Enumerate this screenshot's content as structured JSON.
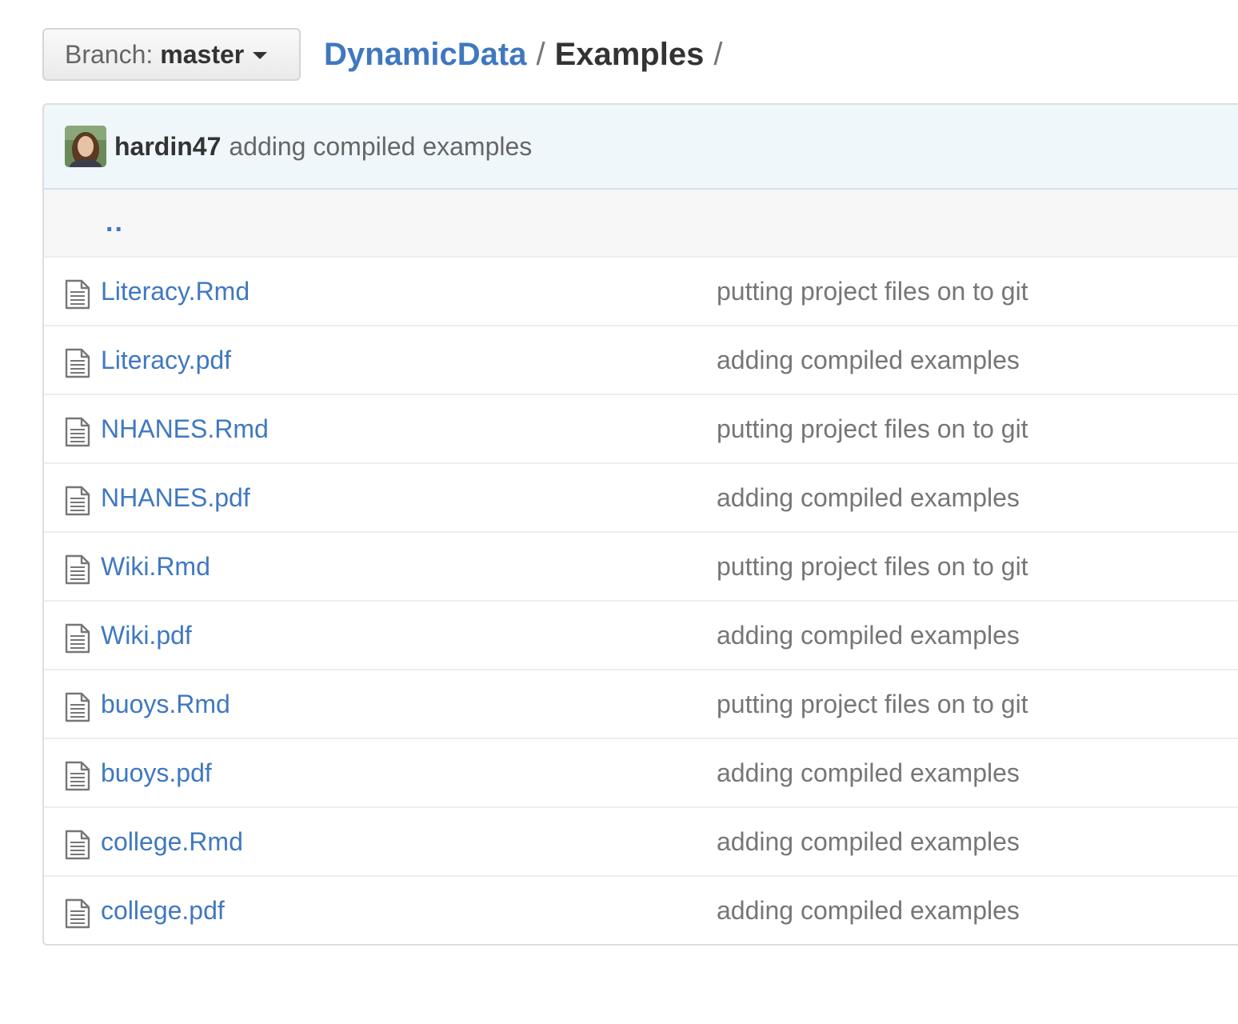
{
  "branch": {
    "prefix": "Branch:",
    "name": "master"
  },
  "breadcrumb": {
    "root": "DynamicData",
    "separator": "/",
    "current": "Examples",
    "trailing": "/"
  },
  "latest_commit": {
    "author": "hardin47",
    "message": "adding compiled examples"
  },
  "parent_dir": "..",
  "files": [
    {
      "name": "Literacy.Rmd",
      "message": "putting project files on to git",
      "icon": "file-text-icon"
    },
    {
      "name": "Literacy.pdf",
      "message": "adding compiled examples",
      "icon": "file-text-icon"
    },
    {
      "name": "NHANES.Rmd",
      "message": "putting project files on to git",
      "icon": "file-text-icon"
    },
    {
      "name": "NHANES.pdf",
      "message": "adding compiled examples",
      "icon": "file-text-icon"
    },
    {
      "name": "Wiki.Rmd",
      "message": "putting project files on to git",
      "icon": "file-text-icon"
    },
    {
      "name": "Wiki.pdf",
      "message": "adding compiled examples",
      "icon": "file-text-icon"
    },
    {
      "name": "buoys.Rmd",
      "message": "putting project files on to git",
      "icon": "file-text-icon"
    },
    {
      "name": "buoys.pdf",
      "message": "adding compiled examples",
      "icon": "file-text-icon"
    },
    {
      "name": "college.Rmd",
      "message": "adding compiled examples",
      "icon": "file-text-icon"
    },
    {
      "name": "college.pdf",
      "message": "adding compiled examples",
      "icon": "file-text-icon"
    }
  ],
  "colors": {
    "link": "#4078c0",
    "muted": "#767676",
    "commit_bar_bg": "#eff7fb"
  }
}
